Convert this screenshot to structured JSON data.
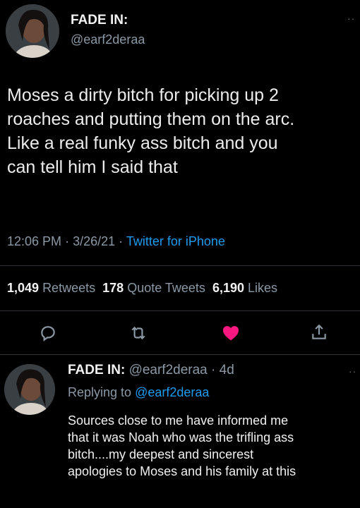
{
  "main_tweet": {
    "author_name": "FADE IN:",
    "author_handle": "@earf2deraa",
    "text_lines": [
      "Moses a dirty bitch for picking up 2",
      "roaches and putting them on the arc.",
      "Like a real funky ass bitch and you",
      "can tell him I said that"
    ],
    "time": "12:06 PM",
    "date": "3/26/21",
    "source": "Twitter for iPhone",
    "separator": "·",
    "stats": {
      "retweets_count": "1,049",
      "retweets_label": "Retweets",
      "quotes_count": "178",
      "quotes_label": "Quote Tweets",
      "likes_count": "6,190",
      "likes_label": "Likes"
    },
    "more_label": "··"
  },
  "actions": [
    {
      "icon": "reply-icon"
    },
    {
      "icon": "retweet-icon"
    },
    {
      "icon": "heart-icon",
      "liked": true,
      "color": "#f91880"
    },
    {
      "icon": "share-icon"
    }
  ],
  "reply_tweet": {
    "author_name": "FADE IN:",
    "author_handle": "@earf2deraa",
    "age": "· 4d",
    "replying_to_label": "Replying to",
    "replying_to_handle": "@earf2deraa",
    "text_lines": [
      "Sources close to me have informed me",
      "that it was Noah who was the trifling ass",
      "bitch....my deepest and sincerest",
      "apologies to Moses and his family at this"
    ],
    "more_label": "··"
  },
  "colors": {
    "background": "#000000",
    "accent": "#1d9bf0",
    "like": "#f91880",
    "muted": "#8b98a5"
  }
}
